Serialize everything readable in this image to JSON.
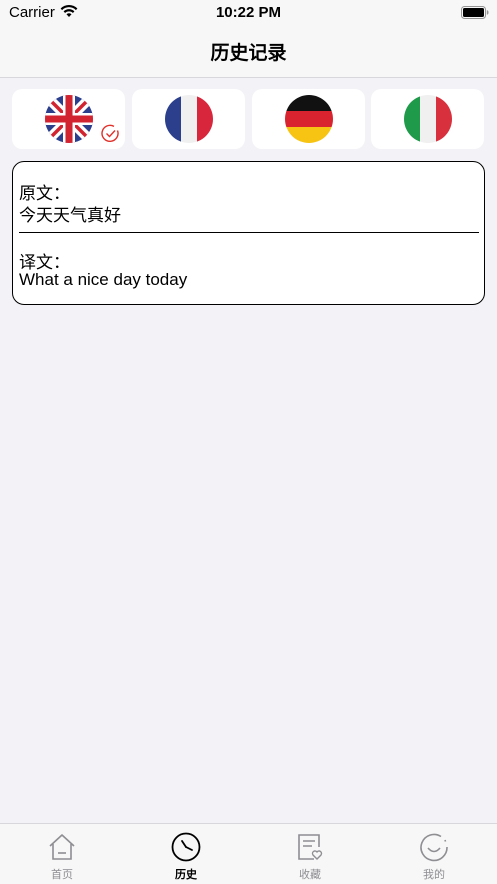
{
  "status_bar": {
    "carrier": "Carrier",
    "time": "10:22 PM"
  },
  "nav": {
    "title": "历史记录"
  },
  "languages": [
    {
      "flag": "uk-flag-icon",
      "selected": true
    },
    {
      "flag": "france-flag-icon",
      "selected": false
    },
    {
      "flag": "germany-flag-icon",
      "selected": false
    },
    {
      "flag": "italy-flag-icon",
      "selected": false
    }
  ],
  "record": {
    "source_label": "原文：",
    "source_text": "今天天气真好",
    "target_label": "译文：",
    "target_text": "What a nice day today"
  },
  "tabs": [
    {
      "label": "首页",
      "icon": "home-icon",
      "active": false
    },
    {
      "label": "历史",
      "icon": "clock-icon",
      "active": true
    },
    {
      "label": "收藏",
      "icon": "favorites-icon",
      "active": false
    },
    {
      "label": "我的",
      "icon": "profile-icon",
      "active": false
    }
  ],
  "colors": {
    "background": "#F2F2F7",
    "bar_background": "#F7F7F7",
    "check_red": "#E0302A",
    "tab_inactive": "#8E8E93"
  }
}
